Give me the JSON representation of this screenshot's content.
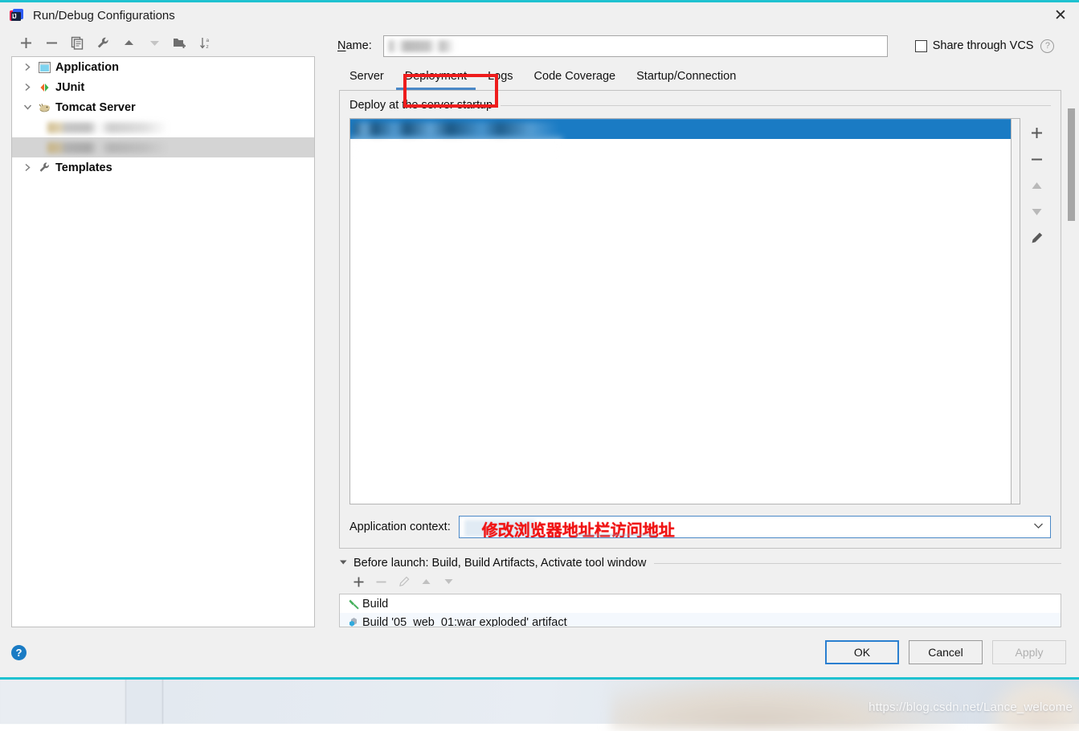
{
  "window": {
    "title": "Run/Debug Configurations",
    "app_icon": "intellij-idea-icon",
    "close_icon": "close-icon"
  },
  "tree_toolbar": {
    "buttons": [
      {
        "name": "add-configuration-button",
        "icon": "plus-icon",
        "label": "+",
        "enabled": true
      },
      {
        "name": "remove-configuration-button",
        "icon": "minus-icon",
        "label": "−",
        "enabled": true
      },
      {
        "name": "copy-configuration-button",
        "icon": "copy-icon",
        "label": "copy",
        "enabled": true
      },
      {
        "name": "edit-templates-button",
        "icon": "wrench-icon",
        "label": "wrench",
        "enabled": true
      },
      {
        "name": "move-up-button",
        "icon": "arrow-up-icon",
        "label": "▲",
        "enabled": true
      },
      {
        "name": "move-down-button",
        "icon": "arrow-down-icon",
        "label": "▼",
        "enabled": false
      },
      {
        "name": "create-folder-button",
        "icon": "folder-add-icon",
        "label": "folder",
        "enabled": true
      },
      {
        "name": "sort-configurations-button",
        "icon": "sort-alphabetical-icon",
        "label": "sort",
        "enabled": true
      }
    ]
  },
  "tree": {
    "items": [
      {
        "label": "Application",
        "icon": "application-icon",
        "expander": "collapsed",
        "level": 0,
        "selected": false,
        "redacted": false
      },
      {
        "label": "JUnit",
        "icon": "junit-icon",
        "expander": "collapsed",
        "level": 0,
        "selected": false,
        "redacted": false
      },
      {
        "label": "Tomcat Server",
        "icon": "tomcat-icon",
        "expander": "expanded",
        "level": 0,
        "selected": false,
        "redacted": false
      },
      {
        "label": "",
        "icon": "tomcat-config-icon",
        "expander": "none",
        "level": 1,
        "selected": false,
        "redacted": true
      },
      {
        "label": "",
        "icon": "tomcat-config-icon",
        "expander": "none",
        "level": 1,
        "selected": true,
        "redacted": true
      },
      {
        "label": "Templates",
        "icon": "templates-wrench-icon",
        "expander": "collapsed",
        "level": 0,
        "selected": false,
        "redacted": false
      }
    ]
  },
  "name_row": {
    "label": "Name:",
    "label_mnemonic": "N",
    "value": "",
    "value_redacted": true,
    "share_vcs_label": "Share through VCS",
    "share_vcs_mnemonic": "S",
    "share_vcs_checked": false,
    "help_icon": "help-circle-icon"
  },
  "tabs": {
    "items": [
      {
        "label": "Server",
        "active": false
      },
      {
        "label": "Deployment",
        "active": true
      },
      {
        "label": "Logs",
        "active": false
      },
      {
        "label": "Code Coverage",
        "active": false
      },
      {
        "label": "Startup/Connection",
        "active": false
      }
    ],
    "active_underline_color": "#4a88c7",
    "annotation_box_color": "#ee1c1c"
  },
  "deployment": {
    "group_title": "Deploy at the server startup",
    "list_rows": [
      {
        "label": "",
        "redacted": true,
        "selected": true
      }
    ],
    "selection_color": "#1a7bc4",
    "side_buttons": [
      {
        "name": "add-artifact-button",
        "icon": "plus-icon",
        "label": "+",
        "enabled": true
      },
      {
        "name": "remove-artifact-button",
        "icon": "minus-icon",
        "label": "−",
        "enabled": true
      },
      {
        "name": "move-artifact-up-button",
        "icon": "arrow-up-icon",
        "label": "▲",
        "enabled": false
      },
      {
        "name": "move-artifact-down-button",
        "icon": "arrow-down-icon",
        "label": "▼",
        "enabled": false
      },
      {
        "name": "edit-artifact-button",
        "icon": "pencil-icon",
        "label": "edit",
        "enabled": true
      }
    ],
    "application_context": {
      "label": "Application context:",
      "value": "",
      "annotation_text": "修改浏览器地址栏访问地址",
      "annotation_color": "#f01414",
      "dropdown_icon": "chevron-down-icon"
    }
  },
  "before_launch": {
    "header": "Before launch: Build, Build Artifacts, Activate tool window",
    "header_mnemonic": "B",
    "caret_icon": "triangle-down-icon",
    "toolbar": [
      {
        "name": "add-task-button",
        "icon": "plus-icon",
        "label": "+",
        "enabled": true
      },
      {
        "name": "remove-task-button",
        "icon": "minus-icon",
        "label": "−",
        "enabled": false
      },
      {
        "name": "edit-task-button",
        "icon": "pencil-icon",
        "label": "edit",
        "enabled": false
      },
      {
        "name": "move-task-up-button",
        "icon": "arrow-up-icon",
        "label": "▲",
        "enabled": false
      },
      {
        "name": "move-task-down-button",
        "icon": "arrow-down-icon",
        "label": "▼",
        "enabled": false
      }
    ],
    "tasks": [
      {
        "label": "Build",
        "icon": "build-hammer-icon"
      },
      {
        "label": "Build '05_web_01:war exploded' artifact",
        "icon": "artifact-icon"
      }
    ]
  },
  "footer": {
    "help_icon": "help-circle-filled-icon",
    "buttons": [
      {
        "name": "ok-button",
        "label": "OK",
        "style": "default",
        "enabled": true
      },
      {
        "name": "cancel-button",
        "label": "Cancel",
        "style": "normal",
        "enabled": true
      },
      {
        "name": "apply-button",
        "label": "Apply",
        "style": "normal",
        "enabled": false
      }
    ]
  },
  "backdrop": {
    "watermark": "https://blog.csdn.net/Lance_welcome"
  },
  "colors": {
    "accent_border": "#1fc2d0",
    "selection_blue": "#1a7bc4",
    "tab_underline": "#4a88c7",
    "annotation_red": "#ee1c1c",
    "dialog_bg": "#f0f0f0"
  }
}
